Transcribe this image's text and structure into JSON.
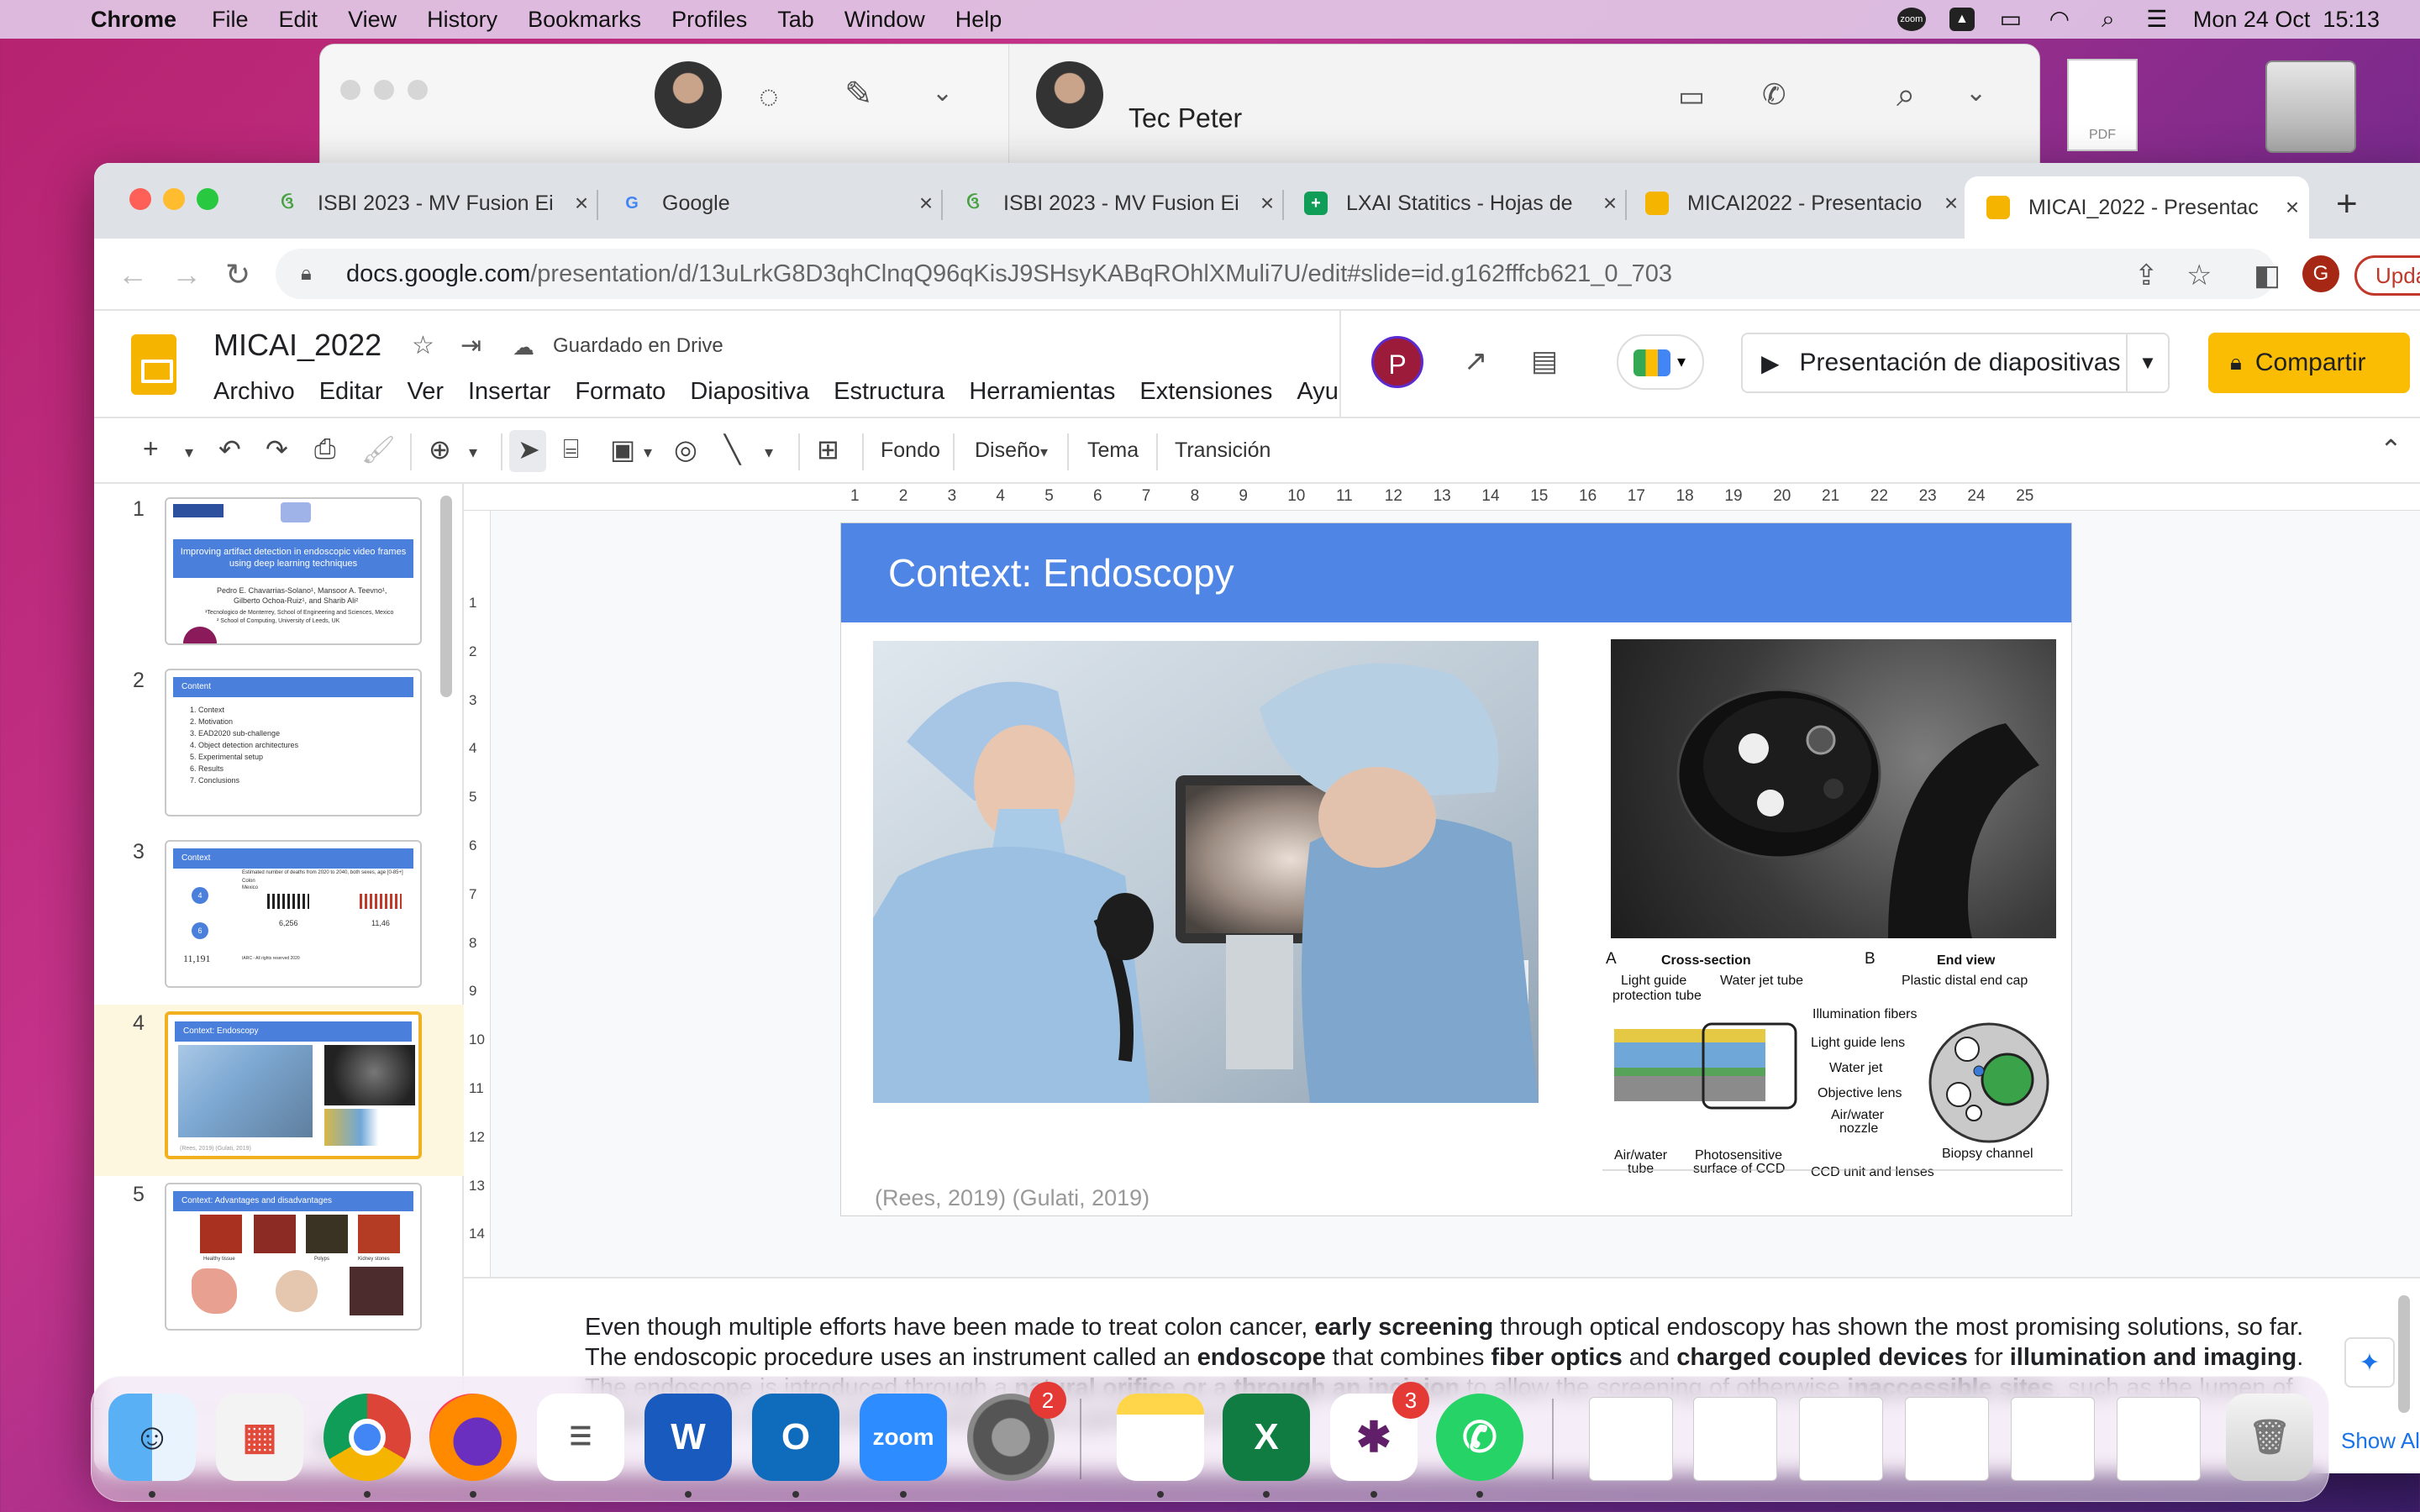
{
  "menubar": {
    "app_name": "Chrome",
    "items": [
      "File",
      "Edit",
      "View",
      "History",
      "Bookmarks",
      "Profiles",
      "Tab",
      "Window",
      "Help"
    ],
    "clock": "Mon 24 Oct  15:13",
    "zoom_badge": "zoom"
  },
  "whatsapp": {
    "contact_name": "Tec Peter"
  },
  "desktop": {
    "pdf_label": "PDF"
  },
  "chrome": {
    "tabs": [
      {
        "title": "ISBI 2023 - MV Fusion Ei",
        "icon": "overleaf-icon"
      },
      {
        "title": "Google",
        "icon": "google-icon"
      },
      {
        "title": "ISBI 2023 - MV Fusion Ei",
        "icon": "overleaf-icon"
      },
      {
        "title": "LXAI Statitics - Hojas de",
        "icon": "sheets-icon"
      },
      {
        "title": "MICAI2022 - Presentacio",
        "icon": "slides-icon"
      },
      {
        "title": "MICAI_2022 - Presentac",
        "icon": "slides-icon",
        "active": true
      }
    ],
    "url_host": "docs.google.com",
    "url_path": "/presentation/d/13uLrkG8D3qhClnqQ96qKisJ9SHsyKABqROhlXMuli7U/edit#slide=id.g162fffcb621_0_703",
    "profile_initial": "G",
    "update_label": "Upda"
  },
  "slides": {
    "doc_title": "MICAI_2022",
    "saved_status": "Guardado en Drive",
    "menus": [
      "Archivo",
      "Editar",
      "Ver",
      "Insertar",
      "Formato",
      "Diapositiva",
      "Estructura",
      "Herramientas",
      "Extensiones",
      "Ayud"
    ],
    "user_initial": "P",
    "present_label": "Presentación de diapositivas",
    "share_label": "Compartir",
    "toolbar": {
      "background": "Fondo",
      "design": "Diseño",
      "theme": "Tema",
      "transition": "Transición"
    },
    "ruler_h": [
      "1",
      "2",
      "3",
      "4",
      "5",
      "6",
      "7",
      "8",
      "9",
      "10",
      "11",
      "12",
      "13",
      "14",
      "15",
      "16",
      "17",
      "18",
      "19",
      "20",
      "21",
      "22",
      "23",
      "24",
      "25"
    ],
    "ruler_v": [
      "1",
      "2",
      "3",
      "4",
      "5",
      "6",
      "7",
      "8",
      "9",
      "10",
      "11",
      "12",
      "13",
      "14"
    ],
    "thumbnails": [
      {
        "num": "1",
        "title": "Improving artifact detection in endoscopic video frames using deep learning techniques",
        "lines": [
          "Pedro E. Chavarrias-Solano¹, Mansoor A. Teevno¹,",
          "Gilberto Ochoa-Ruiz¹, and Sharib Ali²",
          "¹Tecnologico de Monterrey, School of Engineering and Sciences, Mexico",
          "² School of Computing, University of Leeds, UK"
        ]
      },
      {
        "num": "2",
        "title": "Content",
        "lines": [
          "1.   Context",
          "2.   Motivation",
          "3.   EAD2020 sub-challenge",
          "4.   Object detection architectures",
          "5.   Experimental setup",
          "6.   Results",
          "7.   Conclusions"
        ]
      },
      {
        "num": "3",
        "title": "Context",
        "lines": [
          "Estimated number of deaths from 2020 to 2040, both sexes, age [0-85+]",
          "Colon",
          "Mexico",
          "4",
          "6",
          "6,256",
          "11,46",
          "11,191",
          "IARC - All rights reserved 2020"
        ]
      },
      {
        "num": "4",
        "title": "Context: Endoscopy",
        "lines": [
          "(Rees, 2019) (Gulati, 2019)"
        ],
        "selected": true
      },
      {
        "num": "5",
        "title": "Context: Advantages and disadvantages",
        "lines": [
          "Healthy tissue",
          "Polyps",
          "Kidney stones"
        ]
      }
    ],
    "slide": {
      "title": "Context: Endoscopy",
      "citation": "(Rees, 2019) (Gulati, 2019)",
      "diagram": {
        "label_a": "A",
        "label_b": "B",
        "cross_section": "Cross-section",
        "end_view": "End view",
        "labels": [
          "Light guide",
          "protection tube",
          "Water jet tube",
          "Plastic distal end cap",
          "Illumination fibers",
          "Light guide lens",
          "Water jet",
          "Objective lens",
          "Air/water",
          "nozzle",
          "Air/water",
          "tube",
          "Photosensitive",
          "surface of CCD",
          "CCD unit and lenses",
          "Biopsy channel"
        ]
      }
    },
    "notes": {
      "segments": [
        {
          "t": "Even though multiple efforts have been made to treat colon cancer, ",
          "b": false
        },
        {
          "t": "early screening",
          "b": true
        },
        {
          "t": " through optical endoscopy has shown the most promising solutions, so far. The endoscopic procedure uses an instrument called an ",
          "b": false
        },
        {
          "t": "endoscope",
          "b": true
        },
        {
          "t": " that combines ",
          "b": false
        },
        {
          "t": "fiber optics",
          "b": true
        },
        {
          "t": " and ",
          "b": false
        },
        {
          "t": "charged coupled devices",
          "b": true
        },
        {
          "t": " for ",
          "b": false
        },
        {
          "t": "illumination and imaging",
          "b": true
        },
        {
          "t": ". The endoscope is introduced through a ",
          "b": false
        },
        {
          "t": "natural orifice or a through an incision",
          "b": true
        },
        {
          "t": " to allow the screening of otherwise ",
          "b": false
        },
        {
          "t": "inaccessible sites",
          "b": true
        },
        {
          "t": ", such as the lumen of hollow organs, for example, the interior of the gastrointestinal tract.",
          "b": false
        }
      ]
    }
  },
  "dock": {
    "apps": [
      {
        "name": "Finder",
        "icon": "finder-icon",
        "running": true
      },
      {
        "name": "Launchpad",
        "icon": "launchpad-icon",
        "running": false
      },
      {
        "name": "Chrome",
        "icon": "chrome-icon",
        "running": true
      },
      {
        "name": "Firefox",
        "icon": "firefox-icon",
        "running": true
      },
      {
        "name": "Reminders",
        "icon": "reminders-icon",
        "running": false
      },
      {
        "name": "Word",
        "icon": "word-icon",
        "running": true,
        "glyph": "W"
      },
      {
        "name": "Outlook",
        "icon": "outlook-icon",
        "running": true,
        "glyph": "O"
      },
      {
        "name": "Zoom",
        "icon": "zoom-icon",
        "running": true,
        "glyph": "zoom"
      },
      {
        "name": "System Preferences",
        "icon": "settings-icon",
        "running": false,
        "badge": "2"
      },
      {
        "name": "Notes",
        "icon": "notes-icon",
        "running": true
      },
      {
        "name": "Excel",
        "icon": "excel-icon",
        "running": true,
        "glyph": "X"
      },
      {
        "name": "Slack",
        "icon": "slack-icon",
        "running": true,
        "badge": "3"
      },
      {
        "name": "WhatsApp",
        "icon": "whatsapp-icon",
        "running": true
      }
    ],
    "show_all": "Show Al"
  },
  "colors": {
    "slides_yellow": "#fbbc04",
    "slide_title_blue": "#4f86e6",
    "selected_thumb_border": "#f2b01e",
    "chrome_tabstrip": "#dee1e6"
  }
}
